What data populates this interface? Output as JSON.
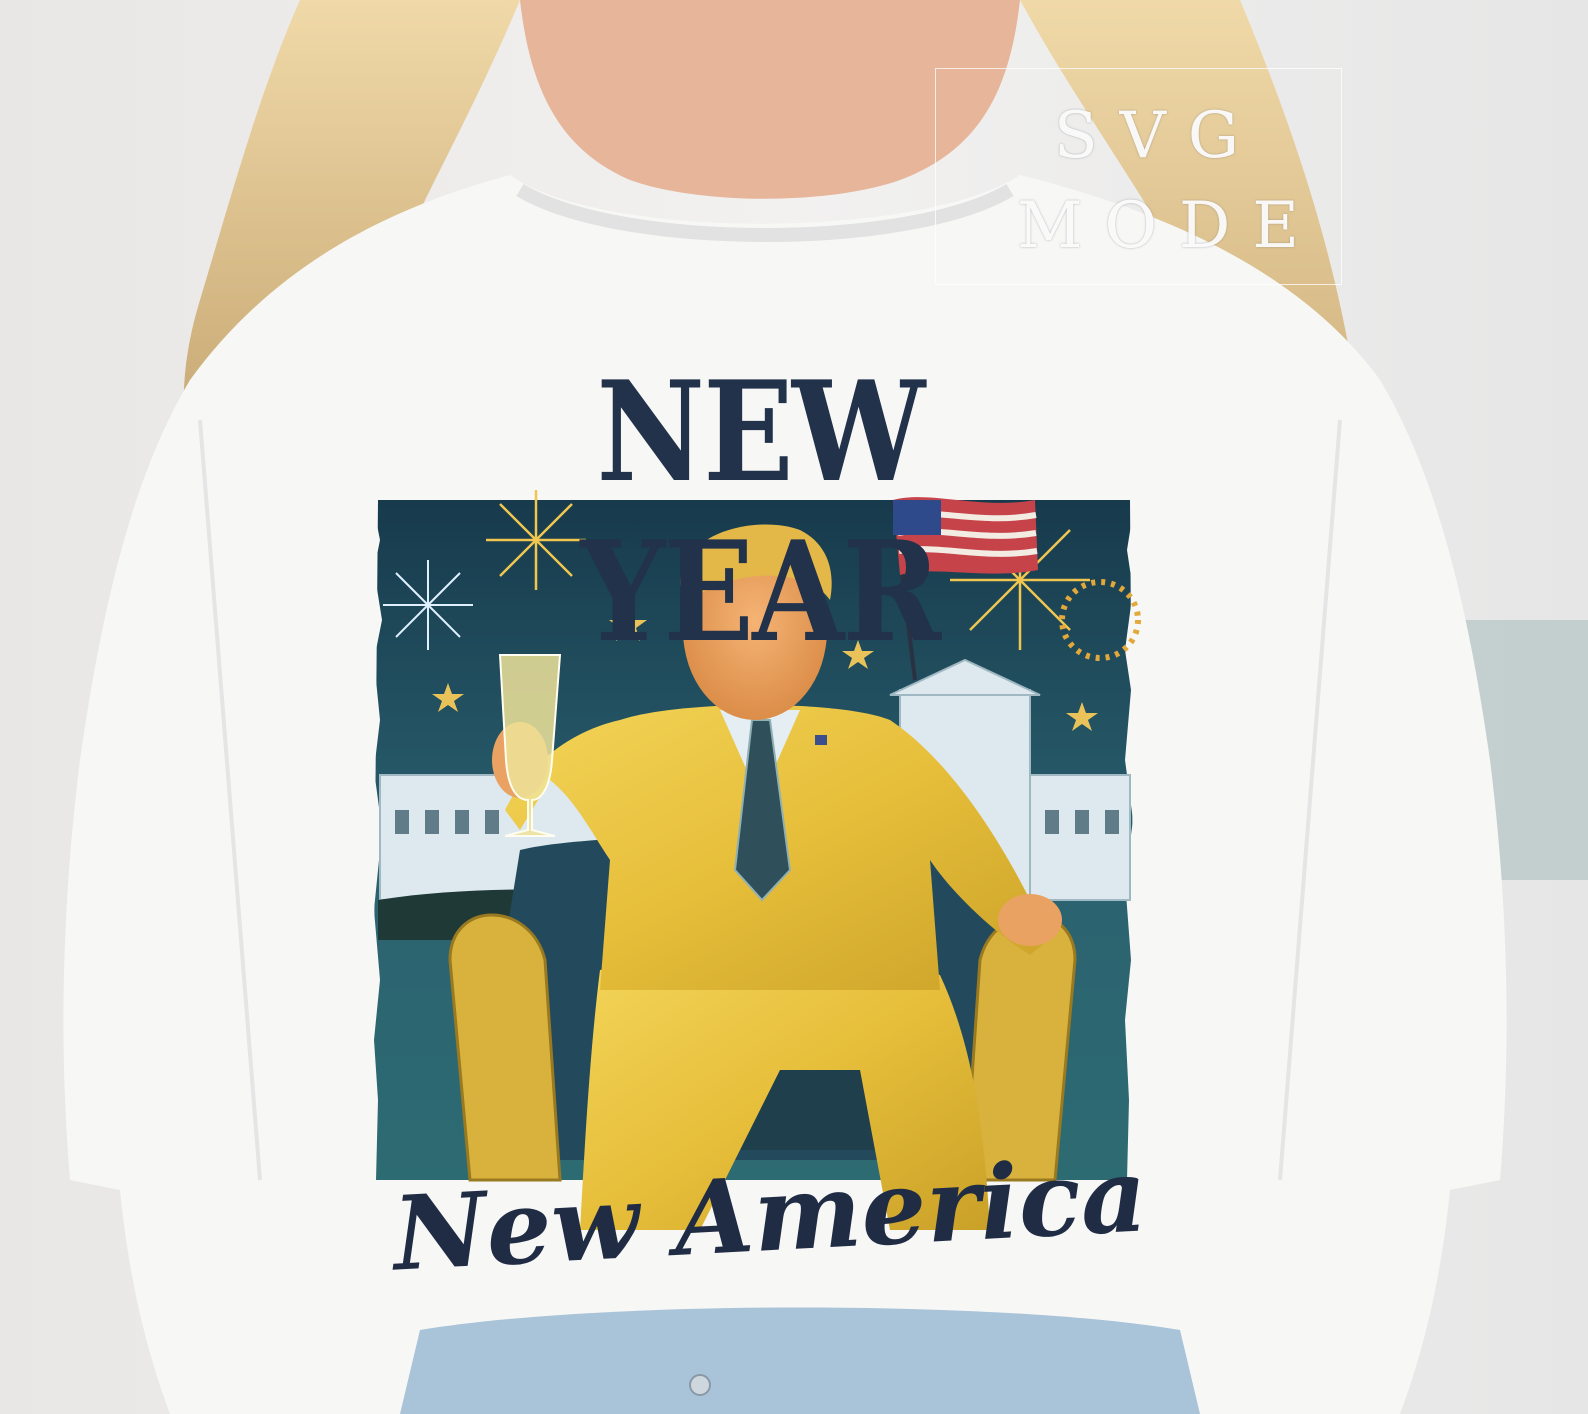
{
  "design": {
    "headline": "NEW YEAR",
    "tagline": "New America"
  },
  "watermark": {
    "line1": "SVG",
    "line2": "MODE"
  },
  "colors": {
    "navy_text": "#22324a",
    "night_teal": "#1f4c5a",
    "gold": "#e2b93b",
    "shirt": "#f7f7f6",
    "denim": "#a9c3d9"
  }
}
